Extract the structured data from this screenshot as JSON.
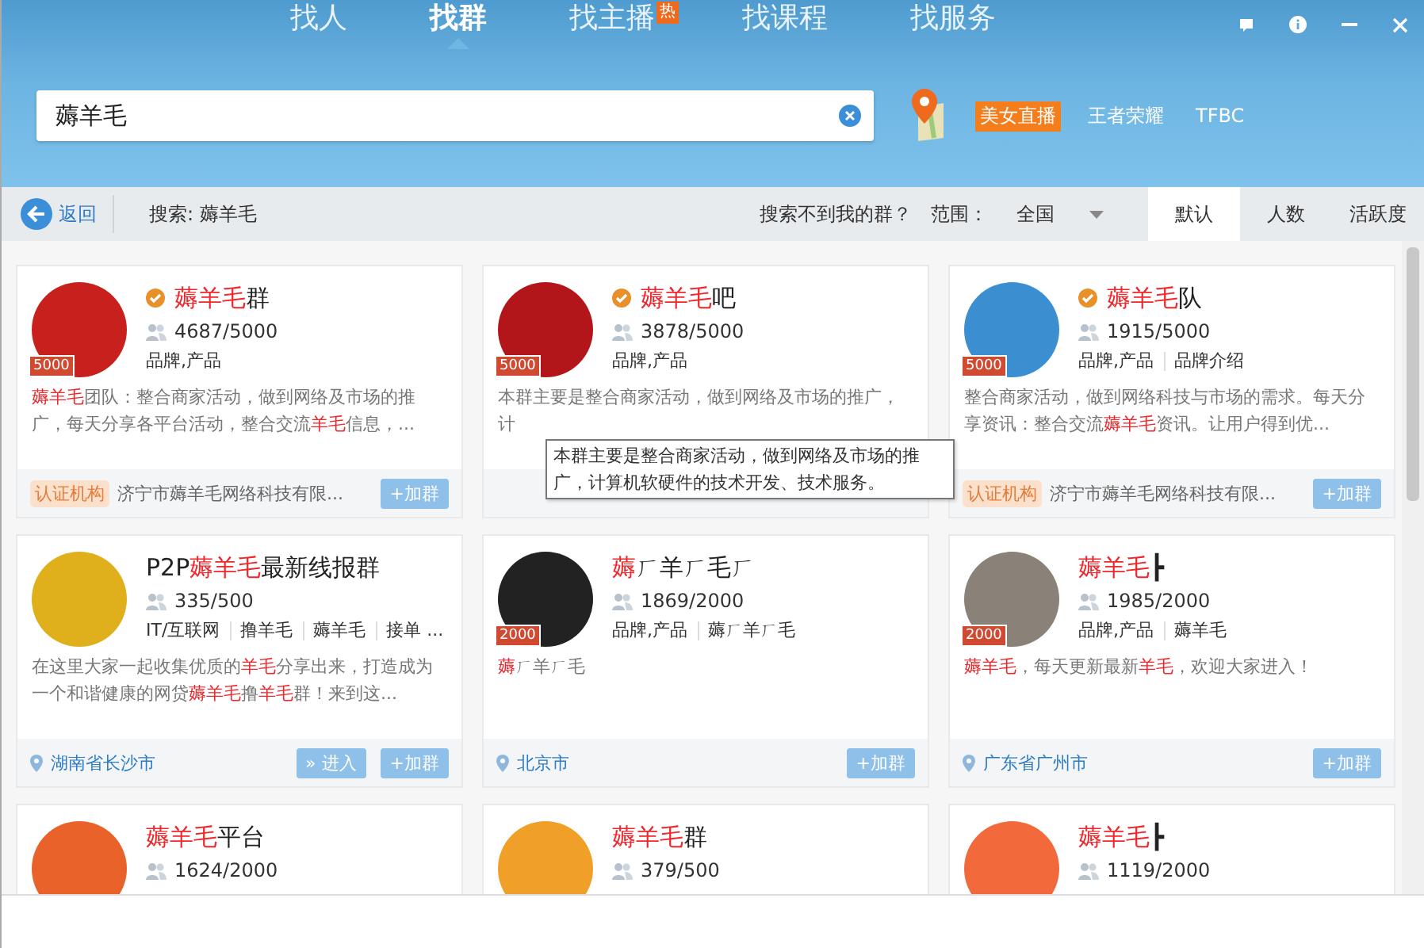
{
  "tabs": [
    {
      "label": "找人",
      "selected": false,
      "hot": false
    },
    {
      "label": "找群",
      "selected": true,
      "hot": false
    },
    {
      "label": "找主播",
      "selected": false,
      "hot": true,
      "badge": "热"
    },
    {
      "label": "找课程",
      "selected": false,
      "hot": false
    },
    {
      "label": "找服务",
      "selected": false,
      "hot": false
    }
  ],
  "search": {
    "value": "薅羊毛"
  },
  "hot_links": [
    {
      "label": "美女直播",
      "highlighted": true
    },
    {
      "label": "王者荣耀",
      "highlighted": false
    },
    {
      "label": "TFBC",
      "highlighted": false
    }
  ],
  "toolbar": {
    "back": "返回",
    "query": "搜索: 薅羊毛",
    "hint": "搜索不到我的群？",
    "range_label": "范围：",
    "range_value": "全国"
  },
  "sort_tabs": [
    {
      "label": "默认",
      "selected": true
    },
    {
      "label": "人数",
      "selected": false
    },
    {
      "label": "活跃度",
      "selected": false
    }
  ],
  "groups": [
    {
      "name": [
        {
          "text": "薅羊毛",
          "highlight": true
        },
        {
          "text": "群",
          "highlight": false
        }
      ],
      "verified": true,
      "badge": "5000",
      "members": "4687/5000",
      "tags": [
        "品牌,产品"
      ],
      "description": [
        {
          "text": "薅羊毛",
          "highlight": true
        },
        {
          "text": "团队：整合商家活动，做到网络及市场的推广，每天分享各平台活动，整合交流",
          "highlight": false
        },
        {
          "text": "羊毛",
          "highlight": true
        },
        {
          "text": "信息，...",
          "highlight": false
        }
      ],
      "footer": {
        "kind": "org",
        "tag": "认证机构",
        "org": "济宁市薅羊毛网络科技有限...",
        "buttons": [
          "+加群"
        ]
      }
    },
    {
      "name": [
        {
          "text": "薅羊毛",
          "highlight": true
        },
        {
          "text": "吧",
          "highlight": false
        }
      ],
      "verified": true,
      "badge": "5000",
      "members": "3878/5000",
      "tags": [
        "品牌,产品"
      ],
      "description": [
        {
          "text": "本群主要是整合商家活动，做到网络及市场的推广，计",
          "highlight": false
        }
      ],
      "footer": {
        "kind": "hidden"
      }
    },
    {
      "name": [
        {
          "text": "薅羊毛",
          "highlight": true
        },
        {
          "text": "队",
          "highlight": false
        }
      ],
      "verified": true,
      "badge": "5000",
      "members": "1915/5000",
      "tags": [
        "品牌,产品",
        "品牌介绍"
      ],
      "description": [
        {
          "text": "整合商家活动，做到网络科技与市场的需求。每天分享资讯：整合交流",
          "highlight": false
        },
        {
          "text": "薅羊毛",
          "highlight": true
        },
        {
          "text": "资讯。让用户得到优...",
          "highlight": false
        }
      ],
      "footer": {
        "kind": "org",
        "tag": "认证机构",
        "org": "济宁市薅羊毛网络科技有限...",
        "buttons": [
          "+加群"
        ]
      }
    },
    {
      "name": [
        {
          "text": "P2P",
          "highlight": false
        },
        {
          "text": "薅羊毛",
          "highlight": true
        },
        {
          "text": "最新线报群",
          "highlight": false
        }
      ],
      "verified": false,
      "members": "335/500",
      "tags": [
        "IT/互联网",
        "撸羊毛",
        "薅羊毛",
        "接单 ..."
      ],
      "description": [
        {
          "text": "在这里大家一起收集优质的",
          "highlight": false
        },
        {
          "text": "羊毛",
          "highlight": true
        },
        {
          "text": "分享出来，打造成为一个和谐健康的网贷",
          "highlight": false
        },
        {
          "text": "薅羊毛",
          "highlight": true
        },
        {
          "text": "撸",
          "highlight": false
        },
        {
          "text": "羊毛",
          "highlight": true
        },
        {
          "text": "群！来到这...",
          "highlight": false
        }
      ],
      "footer": {
        "kind": "location",
        "location": "湖南省长沙市",
        "buttons": [
          "» 进入",
          "+加群"
        ]
      }
    },
    {
      "name": [
        {
          "text": "薅",
          "highlight": true
        },
        {
          "text": "ㄏ羊ㄏ毛ㄏ",
          "highlight": false
        }
      ],
      "verified": false,
      "badge": "2000",
      "members": "1869/2000",
      "tags": [
        "品牌,产品",
        "薅ㄏ羊ㄏ毛"
      ],
      "description": [
        {
          "text": "薅",
          "highlight": true
        },
        {
          "text": "ㄏ羊ㄏ毛",
          "highlight": false
        }
      ],
      "footer": {
        "kind": "location",
        "location": "北京市",
        "buttons": [
          "+加群"
        ]
      }
    },
    {
      "name": [
        {
          "text": "薅羊毛",
          "highlight": true
        },
        {
          "text": "┣",
          "highlight": false
        }
      ],
      "verified": false,
      "badge": "2000",
      "members": "1985/2000",
      "tags": [
        "品牌,产品",
        "薅羊毛"
      ],
      "description": [
        {
          "text": "薅羊毛",
          "highlight": true
        },
        {
          "text": "，每天更新最新",
          "highlight": false
        },
        {
          "text": "羊毛",
          "highlight": true
        },
        {
          "text": "，欢迎大家进入！",
          "highlight": false
        }
      ],
      "footer": {
        "kind": "location",
        "location": "广东省广州市",
        "buttons": [
          "+加群"
        ]
      }
    },
    {
      "name": [
        {
          "text": "薅羊毛",
          "highlight": true
        },
        {
          "text": "平台",
          "highlight": false
        }
      ],
      "verified": false,
      "members": "1624/2000"
    },
    {
      "name": [
        {
          "text": "薅羊毛",
          "highlight": true
        },
        {
          "text": "群",
          "highlight": false
        }
      ],
      "verified": false,
      "members": "379/500"
    },
    {
      "name": [
        {
          "text": "薅羊毛",
          "highlight": true
        },
        {
          "text": "┣",
          "highlight": false
        }
      ],
      "verified": false,
      "members": "1119/2000"
    }
  ],
  "tooltip": {
    "text": "本群主要是整合商家活动，做到网络及市场的推广，计算机软硬件的技术开发、技术服务。"
  }
}
